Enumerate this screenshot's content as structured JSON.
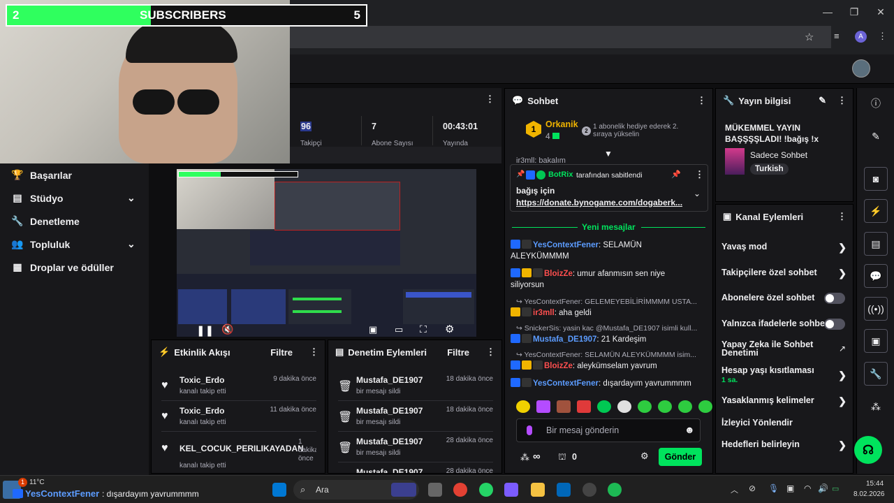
{
  "overlay": {
    "sub_current": "2",
    "sub_label": "SUBSCRIBERS",
    "sub_goal": "5",
    "sub_progress": 0.4
  },
  "browser": {
    "profile_initial": "A",
    "minimize": "—",
    "restore": "❐",
    "close": "✕"
  },
  "stats": {
    "viewers_value": "96",
    "viewers_label": "Takipçi",
    "subs_value": "7",
    "subs_label": "Abone Sayısı",
    "uptime_value": "00:43:01",
    "uptime_label": "Yayında"
  },
  "sidebar": {
    "items": [
      {
        "label": "Başarılar",
        "icon": "trophy-icon"
      },
      {
        "label": "Stüdyo",
        "icon": "studio-icon",
        "chevron": "⌄"
      },
      {
        "label": "Denetleme",
        "icon": "wrench-icon"
      },
      {
        "label": "Topluluk",
        "icon": "people-icon",
        "chevron": "⌄"
      },
      {
        "label": "Droplar ve ödüller",
        "icon": "gift-icon"
      }
    ]
  },
  "activity": {
    "title": "Etkinlik Akışı",
    "filter": "Filtre",
    "items": [
      {
        "name": "Toxic_Erdo",
        "action": "kanalı takip etti",
        "time": "9 dakika önce"
      },
      {
        "name": "Toxic_Erdo",
        "action": "kanalı takip etti",
        "time": "11 dakika önce"
      },
      {
        "name": "KEL_COCUK_PERILIKAYADAN",
        "action": "kanalı takip etti",
        "time": "1 dakika önce"
      }
    ]
  },
  "modlog": {
    "title": "Denetim Eylemleri",
    "filter": "Filtre",
    "items": [
      {
        "name": "Mustafa_DE1907",
        "action": "bir mesajı sildi",
        "time": "18 dakika önce"
      },
      {
        "name": "Mustafa_DE1907",
        "action": "bir mesajı sildi",
        "time": "18 dakika önce"
      },
      {
        "name": "Mustafa_DE1907",
        "action": "bir mesajı sildi",
        "time": "28 dakika önce"
      },
      {
        "name": "Mustafa_DE1907",
        "action": "",
        "time": "28 dakika önce"
      }
    ]
  },
  "chat": {
    "title": "Sohbet",
    "leader_name": "Orkanik",
    "leader_rank": "1",
    "leader_count": "4",
    "leader_second_rank": "2",
    "leader_note": "1 abonelik hediye ederek 2. sıraya yükselin",
    "scrolled_msg": "ir3mll: bakalım",
    "pinned_by": "BotRix",
    "pinned_suffix": "tarafından sabitlendi",
    "pinned_text": "bağış için",
    "pinned_link": "https://donate.bynogame.com/dogaberk...",
    "new_messages": "Yeni mesajlar",
    "messages": [
      {
        "user": "YesContextFener",
        "color": "#5c9cff",
        "text": ": SELAMÜN ALEYKÜMMMM"
      },
      {
        "user": "BloizZe",
        "color": "#ff4f4f",
        "text": ": umur afanmısın sen niye siliyorsun"
      },
      {
        "reply": "↪ YesContextFener: GELEMEYEBİLİRİMMMM USTA..."
      },
      {
        "user": "ir3mll",
        "color": "#ff4f4f",
        "text": ": aha geldi"
      },
      {
        "reply": "↪ SnickerSis: yasin kac @Mustafa_DE1907 isimli kull..."
      },
      {
        "user": "Mustafa_DE1907",
        "color": "#5c9cff",
        "text": ": 21 Kardeşim"
      },
      {
        "reply": "↪ YesContextFener: SELAMÜN ALEYKÜMMMM isim..."
      },
      {
        "user": "BloizZe",
        "color": "#ff4f4f",
        "text": ": aleykümselam yavrum"
      },
      {
        "user": "YesContextFener",
        "color": "#5c9cff",
        "text": ": dışardayım yavrummmm"
      }
    ],
    "input_placeholder": "Bir mesaj gönderin",
    "points": "∞",
    "drops": "0",
    "send": "Gönder"
  },
  "stream_info": {
    "title": "Yayın bilgisi",
    "stream_title": "MÜKEMMEL YAYIN BAŞŞŞŞLADI! !bağış !x",
    "category": "Sadece Sohbet",
    "tag": "Turkish"
  },
  "channel_actions": {
    "title": "Kanal Eylemleri",
    "items": [
      {
        "label": "Yavaş mod",
        "kind": "chevron"
      },
      {
        "label": "Takipçilere özel sohbet",
        "kind": "chevron"
      },
      {
        "label": "Abonelere özel sohbet",
        "kind": "toggle"
      },
      {
        "label": "Yalnızca ifadelerle sohbet",
        "kind": "toggle"
      },
      {
        "label": "Yapay Zeka ile Sohbet Denetimi",
        "kind": "external"
      },
      {
        "label": "Hesap yaşı kısıtlaması",
        "sub": "1 sa.",
        "kind": "chevron"
      },
      {
        "label": "Yasaklanmış kelimeler",
        "kind": "chevron"
      },
      {
        "label": "İzleyici Yönlendir",
        "kind": "none"
      },
      {
        "label": "Hedefleri belirleyin",
        "kind": "chevron"
      }
    ]
  },
  "taskbar": {
    "weather": "11°C",
    "weather_badge": "1",
    "notification_user": "YesContextFener",
    "notification_text": ": dışardayım yavrummmm",
    "search": "Ara",
    "time": "15:44",
    "date": "8.02.2026"
  },
  "colors": {
    "accent_green": "#00e35d",
    "overlay_green": "#2fff5e",
    "twitch_purple": "#9147ff",
    "user_blue": "#5c9cff",
    "user_red": "#ff4f4f"
  }
}
